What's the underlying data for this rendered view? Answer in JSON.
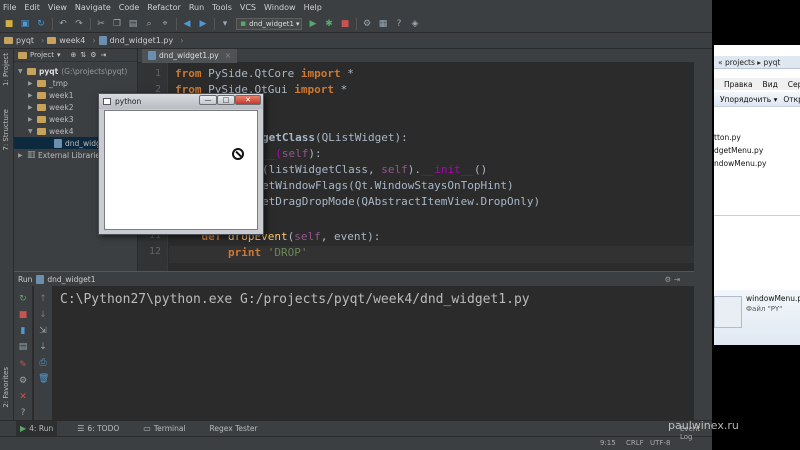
{
  "menubar": [
    "File",
    "Edit",
    "View",
    "Navigate",
    "Code",
    "Refactor",
    "Run",
    "Tools",
    "VCS",
    "Window",
    "Help"
  ],
  "toolbar": {
    "run_config": "dnd_widget1"
  },
  "breadcrumb": {
    "project": "pyqt",
    "folder": "week4",
    "file": "dnd_widget1.py"
  },
  "left_strip": {
    "project_tab": "1: Project",
    "structure_tab": "7: Structure",
    "favorites_tab": "2: Favorites"
  },
  "project_panel": {
    "header": "Project",
    "root": "pyqt",
    "root_path": "(G:\\projects\\pyqt)",
    "items": [
      "_tmp",
      "week1",
      "week2",
      "week3",
      "week4",
      "dnd_widge",
      "External Libraries"
    ]
  },
  "editor": {
    "tab": "dnd_widget1.py",
    "line_numbers": [
      "1",
      "2",
      "11",
      "12"
    ],
    "lines": {
      "l1": {
        "kw1": "from",
        "mod": " PySide.QtCore ",
        "kw2": "import",
        "rest": " *"
      },
      "l2": {
        "kw1": "from",
        "mod": " PySide.QtGui ",
        "kw2": "import",
        "rest": " *"
      },
      "l5": {
        "cls": "getClass",
        "rest": "(QListWidget):"
      },
      "l6": {
        "pre": "__(",
        "self": "self",
        "post": "):"
      },
      "l7": {
        "pre": "(listWidgetClass, ",
        "self": "self",
        "mid": ").",
        "dunder": "__init__",
        "post": "()"
      },
      "l8": "etWindowFlags(Qt.WindowStaysOnTopHint)",
      "l9": "etDragDropMode(QAbstractItemView.DropOnly)",
      "l11": {
        "kw": "def",
        "fn": " dropEvent",
        "pre": "(",
        "self": "self",
        "post": ", event):"
      },
      "l12": {
        "kw": "print",
        "str": " 'DROP'"
      }
    }
  },
  "python_window": {
    "title": "python",
    "minimize": "—",
    "maximize": "□",
    "close": "✕"
  },
  "run_panel": {
    "header_label": "Run",
    "header_config": "dnd_widget1",
    "console": "C:\\Python27\\python.exe G:/projects/pyqt/week4/dnd_widget1.py"
  },
  "bottom_tabs": [
    "4: Run",
    "6: TODO",
    "Terminal",
    "Regex Tester"
  ],
  "status_bar": {
    "position": "9:15",
    "line_sep": "CRLF",
    "encoding": "UTF-8",
    "event_log": "Event Log"
  },
  "explorer": {
    "address": "« projects ▸ pyqt",
    "menu": [
      "Правка",
      "Вид",
      "Сервис"
    ],
    "commands": [
      "Упорядочить ▾",
      "Открыть"
    ],
    "files": [
      "tton.py",
      "dgetMenu.py",
      "ndowMenu.py"
    ],
    "detail_name": "windowMenu.py",
    "detail_type": "Файл \"PY\""
  },
  "watermark": "paulwinex.ru",
  "colors": {
    "ide_bg": "#3c3f41",
    "editor_bg": "#2b2b2b",
    "keyword": "#cc7832",
    "string": "#6a8759",
    "self": "#94558d"
  }
}
